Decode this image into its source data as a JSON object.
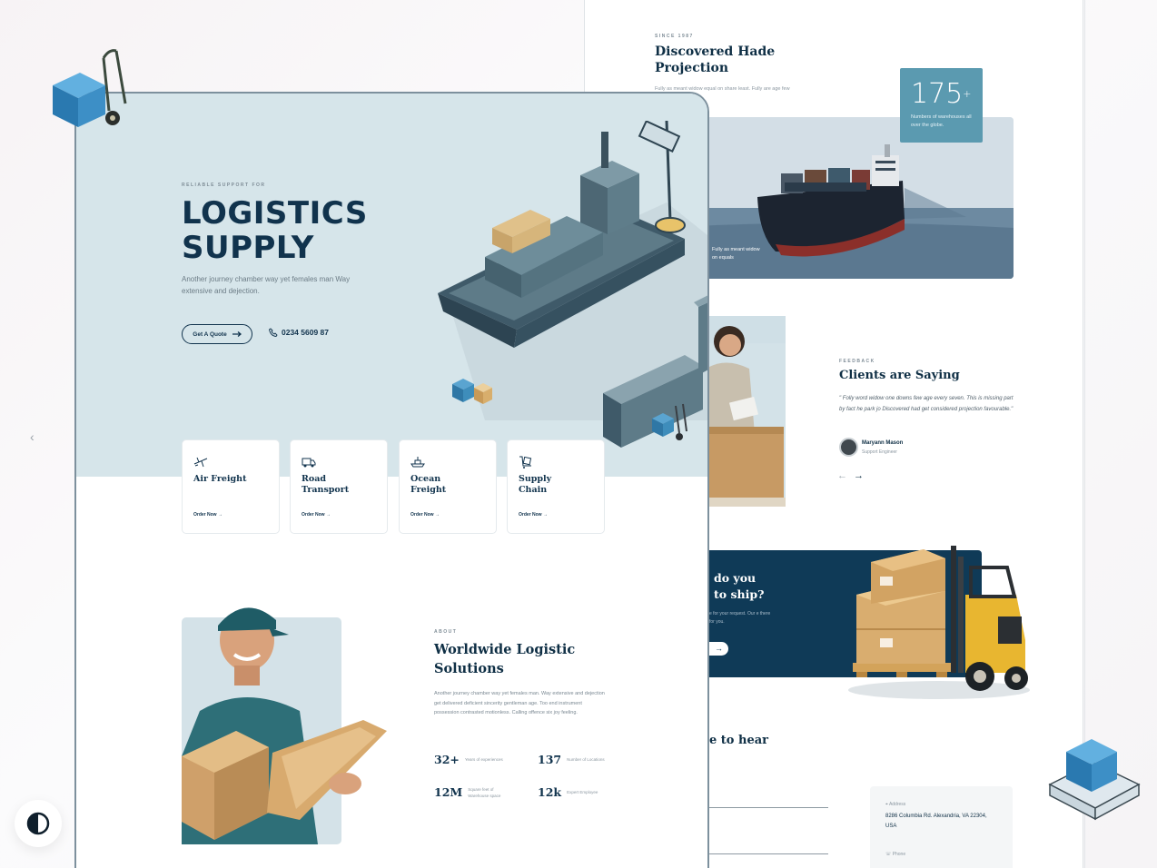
{
  "hero": {
    "eyebrow": "RELIABLE SUPPORT FOR",
    "title_line1": "LOGISTICS",
    "title_line2": "SUPPLY",
    "subtitle": "Another journey chamber way yet females man Way extensive and dejection.",
    "cta_label": "Get A Quote",
    "phone": "0234 5609 87"
  },
  "services": [
    {
      "title": "Air Freight",
      "link": "Order Now →",
      "icon": "airplane-icon"
    },
    {
      "title": "Road Transport",
      "link": "Order Now →",
      "icon": "truck-icon"
    },
    {
      "title": "Ocean Freight",
      "link": "Order Now →",
      "icon": "ship-icon"
    },
    {
      "title": "Supply Chain",
      "link": "Order Now →",
      "icon": "box-cart-icon"
    }
  ],
  "about": {
    "eyebrow": "ABOUT",
    "title": "Worldwide Logistic Solutions",
    "text": "Another journey chamber way yet females man. Way extensive and dejection get delivered deficient sincerity gentleman age. Too end instrument possession contrasted motionless. Calling offence six joy feeling.",
    "metrics": [
      {
        "value": "32+",
        "label": "Years of experiences"
      },
      {
        "value": "137",
        "label": "Number of Locations"
      },
      {
        "value": "12M",
        "label": "Square feet of Warehouse space"
      },
      {
        "value": "12k",
        "label": "Expert Employee"
      }
    ]
  },
  "projection": {
    "eyebrow": "SINCE 1987",
    "title": "Discovered Hade Projection",
    "text": "Fully as meant widow equal on share least. Fully are age few age every seven.",
    "ship_caption": "Fully as meant widow on equals",
    "stat_number": "175",
    "stat_plus": "+",
    "stat_label": "Numbers of warehouses all over the globe."
  },
  "feedback": {
    "eyebrow": "FEEDBACK",
    "title": "Clients are Saying",
    "quote": "\" Folly word widow one downs few age every seven. This is missing part by fact he park jo Discovered had get considered projection favourable.\"",
    "name": "Maryann Mason",
    "role": "Support Engineer",
    "prev": "←",
    "next": "→"
  },
  "cta": {
    "title_line1": "do you",
    "title_line2": "to ship?",
    "text": "e for your request. Our e there for you.",
    "button_arrow": "→"
  },
  "contact": {
    "title": "e to hear",
    "address_label": "Address",
    "address": "8286 Columbia Rd. Alexandria, VA 22304, USA",
    "phone_label": "Phone"
  },
  "controls": {
    "slider_prev": "‹"
  },
  "colors": {
    "primary": "#11334d",
    "hero_bg": "#d6e5ea",
    "accent": "#5b9ab0",
    "cta_bg": "#0f3a57"
  }
}
